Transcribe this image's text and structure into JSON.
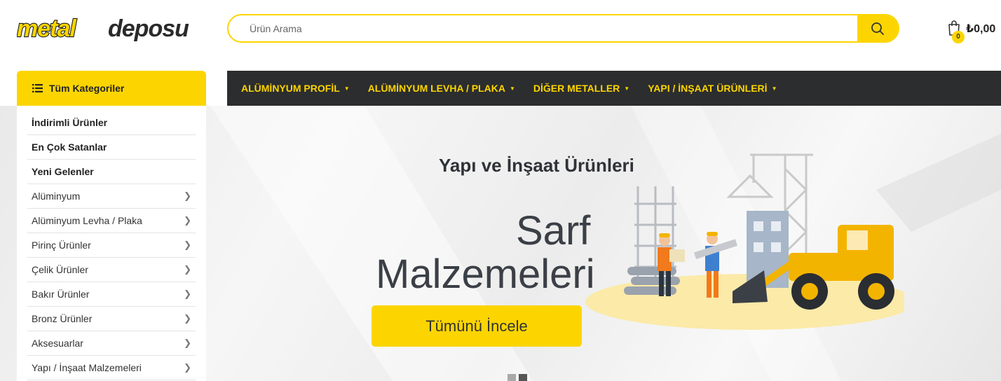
{
  "header": {
    "logo_part1": "metal",
    "logo_part2": "deposu",
    "search_placeholder": "Ürün Arama",
    "cart_count": "0",
    "cart_total": "₺0,00",
    "accent_color": "#fcd500"
  },
  "categories": {
    "title": "Tüm Kategoriler",
    "items": [
      {
        "label": "İndirimli Ürünler",
        "bold": true,
        "arrow": false
      },
      {
        "label": "En Çok Satanlar",
        "bold": true,
        "arrow": false
      },
      {
        "label": "Yeni Gelenler",
        "bold": true,
        "arrow": false
      },
      {
        "label": "Alüminyum",
        "bold": false,
        "arrow": true
      },
      {
        "label": "Alüminyum Levha / Plaka",
        "bold": false,
        "arrow": true
      },
      {
        "label": "Pirinç Ürünler",
        "bold": false,
        "arrow": true
      },
      {
        "label": "Çelik Ürünler",
        "bold": false,
        "arrow": true
      },
      {
        "label": "Bakır Ürünler",
        "bold": false,
        "arrow": true
      },
      {
        "label": "Bronz Ürünler",
        "bold": false,
        "arrow": true
      },
      {
        "label": "Aksesuarlar",
        "bold": false,
        "arrow": true
      },
      {
        "label": "Yapı / İnşaat Malzemeleri",
        "bold": false,
        "arrow": true
      }
    ]
  },
  "nav": {
    "items": [
      "ALÜMİNYUM PROFİL",
      "ALÜMİNYUM LEVHA / PLAKA",
      "DİĞER METALLER",
      "YAPI / İNŞAAT ÜRÜNLERİ"
    ]
  },
  "hero": {
    "title": "Yapı ve İnşaat Ürünleri",
    "line1": "Sarf",
    "line2": "Malzemeleri",
    "button": "Tümünü İncele"
  },
  "icons": {
    "search": "search-icon",
    "cart": "shopping-bag-icon",
    "menu": "list-icon",
    "chevron": "chevron-right-icon",
    "caret": "caret-down-icon"
  }
}
